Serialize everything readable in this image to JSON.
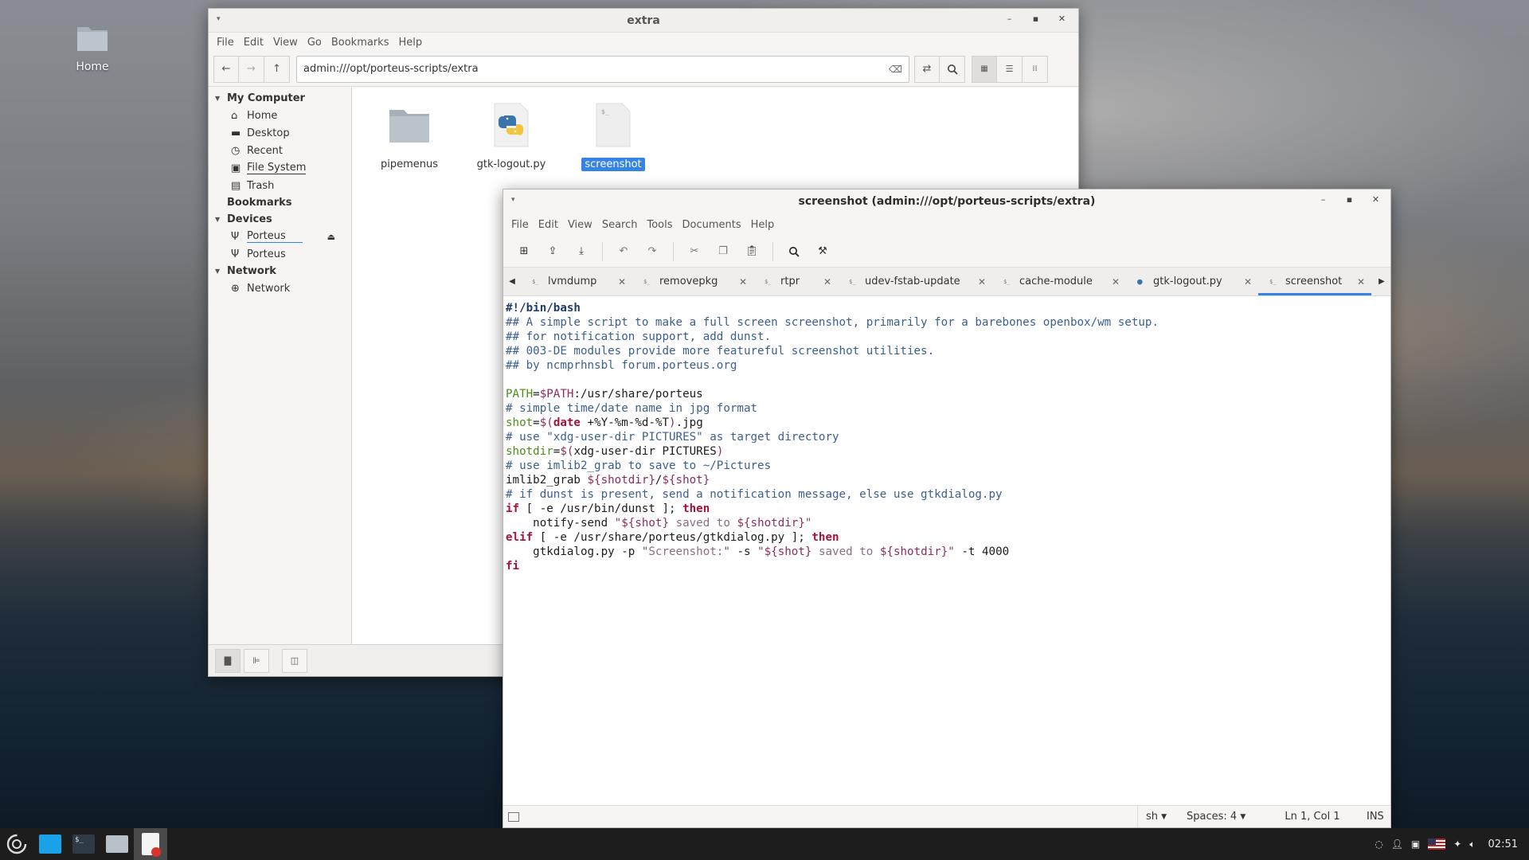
{
  "desktop": {
    "home_label": "Home"
  },
  "file_manager": {
    "title": "extra",
    "menu": [
      "File",
      "Edit",
      "View",
      "Go",
      "Bookmarks",
      "Help"
    ],
    "address": "admin:///opt/porteus-scripts/extra",
    "sidebar": {
      "my_computer": "My Computer",
      "places": [
        "Home",
        "Desktop",
        "Recent",
        "File System",
        "Trash"
      ],
      "bookmarks": "Bookmarks",
      "devices": "Devices",
      "device_items": [
        "Porteus",
        "Porteus"
      ],
      "network": "Network",
      "network_items": [
        "Network"
      ]
    },
    "files": [
      {
        "name": "pipemenus",
        "icon": "folder-icon"
      },
      {
        "name": "gtk-logout.py",
        "icon": "python-file-icon"
      },
      {
        "name": "screenshot",
        "icon": "script-file-icon",
        "selected": true
      }
    ]
  },
  "editor": {
    "title": "screenshot (admin:///opt/porteus-scripts/extra)",
    "menu": [
      "File",
      "Edit",
      "View",
      "Search",
      "Tools",
      "Documents",
      "Help"
    ],
    "tabs": [
      {
        "label": "lvmdump",
        "icon": "script-icon"
      },
      {
        "label": "removepkg",
        "icon": "script-icon"
      },
      {
        "label": "rtpr",
        "icon": "script-icon"
      },
      {
        "label": "udev-fstab-update",
        "icon": "script-icon"
      },
      {
        "label": "cache-module",
        "icon": "script-icon"
      },
      {
        "label": "gtk-logout.py",
        "icon": "python-icon"
      },
      {
        "label": "screenshot",
        "icon": "script-icon",
        "active": true
      }
    ],
    "code_lines": [
      "#!/bin/bash",
      "## A simple script to make a full screen screenshot, primarily for a barebones openbox/wm setup.",
      "## for notification support, add dunst.",
      "## 003-DE modules provide more featureful screenshot utilities.",
      "## by ncmprhnsbl forum.porteus.org",
      "",
      "PATH=$PATH:/usr/share/porteus",
      "# simple time/date name in jpg format",
      "shot=$(date +%Y-%m-%d-%T).jpg",
      "# use \"xdg-user-dir PICTURES\" as target directory",
      "shotdir=$(xdg-user-dir PICTURES)",
      "# use imlib2_grab to save to ~/Pictures",
      "imlib2_grab ${shotdir}/${shot}",
      "# if dunst is present, send a notification message, else use gtkdialog.py",
      "if [ -e /usr/bin/dunst ]; then",
      "    notify-send \"${shot} saved to ${shotdir}\"",
      "elif [ -e /usr/share/porteus/gtkdialog.py ]; then",
      "    gtkdialog.py -p \"Screenshot:\" -s \"${shot} saved to ${shotdir}\" -t 4000",
      "fi"
    ],
    "status": {
      "language": "sh",
      "spaces": "Spaces: 4",
      "position": "Ln 1, Col 1",
      "mode": "INS"
    }
  },
  "taskbar": {
    "clock": "02:51"
  }
}
